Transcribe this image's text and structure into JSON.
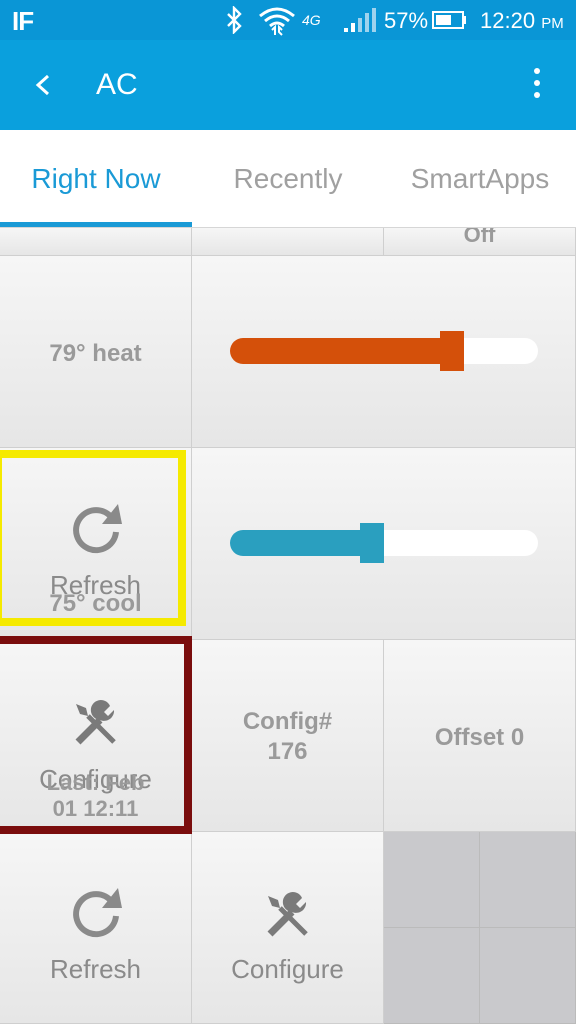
{
  "status_bar": {
    "app_badge": "IF",
    "network": "4G",
    "battery": "57%",
    "time": "12:20",
    "ampm": "PM"
  },
  "app_bar": {
    "title": "AC"
  },
  "tabs": [
    {
      "label": "Right Now",
      "active": true
    },
    {
      "label": "Recently",
      "active": false
    },
    {
      "label": "SmartApps",
      "active": false
    }
  ],
  "tiles": {
    "top_partial_label": "Off",
    "heat": {
      "label": "79° heat",
      "level": 0.72,
      "color": "#d4500a"
    },
    "cool": {
      "label": "75° cool",
      "level": 0.46,
      "color": "#2a9fbf"
    },
    "refresh_overlay": "Refresh",
    "configure_overlay": "Configure",
    "last_label": "Last: Feb",
    "last_label_2": "01 12:11",
    "config": {
      "line1": "Config#",
      "line2": "176"
    },
    "offset": "Offset 0",
    "refresh": "Refresh",
    "configure": "Configure"
  },
  "colors": {
    "status_bar": "#0a96d6",
    "app_bar": "#0aa0dd",
    "tab_active": "#1a9ad6",
    "highlight_yellow": "#f5ea00",
    "highlight_red": "#7a0d0d"
  }
}
